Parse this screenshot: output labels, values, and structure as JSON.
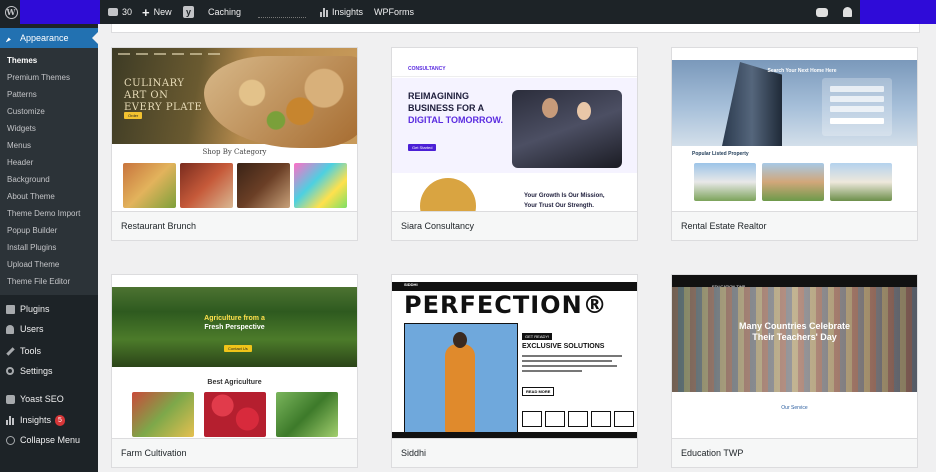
{
  "admin_bar": {
    "comments_count": "30",
    "new_label": "New",
    "caching_label": "Caching",
    "insights_label": "Insights",
    "wpforms_label": "WPForms"
  },
  "sidebar": {
    "appearance_label": "Appearance",
    "submenu": [
      "Themes",
      "Premium Themes",
      "Patterns",
      "Customize",
      "Widgets",
      "Menus",
      "Header",
      "Background",
      "About Theme",
      "Theme Demo Import",
      "Popup Builder",
      "Install Plugins",
      "Upload Theme",
      "Theme File Editor"
    ],
    "items": {
      "plugins": "Plugins",
      "users": "Users",
      "tools": "Tools",
      "settings": "Settings",
      "yoast": "Yoast SEO",
      "insights": "Insights",
      "insights_badge": "5",
      "collapse": "Collapse Menu"
    }
  },
  "themes": [
    {
      "name": "Restaurant Brunch"
    },
    {
      "name": "Siara Consultancy"
    },
    {
      "name": "Rental Estate Realtor"
    },
    {
      "name": "Farm Cultivation"
    },
    {
      "name": "Siddhi"
    },
    {
      "name": "Education TWP"
    }
  ],
  "previews": {
    "restaurant": {
      "title_l1": "CULINARY",
      "title_l2": "ART ON",
      "title_l3": "EVERY PLATE",
      "category": "Shop By Category"
    },
    "siara": {
      "logo": "CONSULTANCY",
      "h1_l1": "REIMAGINING",
      "h1_l2": "BUSINESS FOR A",
      "h1_l3": "DIGITAL TOMORROW.",
      "h2_l1": "Your Growth Is Our Mission,",
      "h2_l2": "Your Trust Our Strength."
    },
    "realtor": {
      "search_title": "Search Your Next Home Here",
      "popular": "Popular Listed Property"
    },
    "farm": {
      "title_l1": "Agriculture from a",
      "title_l2": "Fresh Perspective",
      "best": "Best Agriculture"
    },
    "siddhi": {
      "brand": "SIDDHI",
      "hero": "PERFECTION®",
      "get_ready": "GET READY!",
      "exclusive": "EXCLUSIVE SOLUTIONS",
      "read_more": "READ MORE"
    },
    "education": {
      "brand": "EDUCATION TWP",
      "title_l1": "Many Countries Celebrate",
      "title_l2": "Their Teachers' Day",
      "service": "Our Service"
    }
  }
}
